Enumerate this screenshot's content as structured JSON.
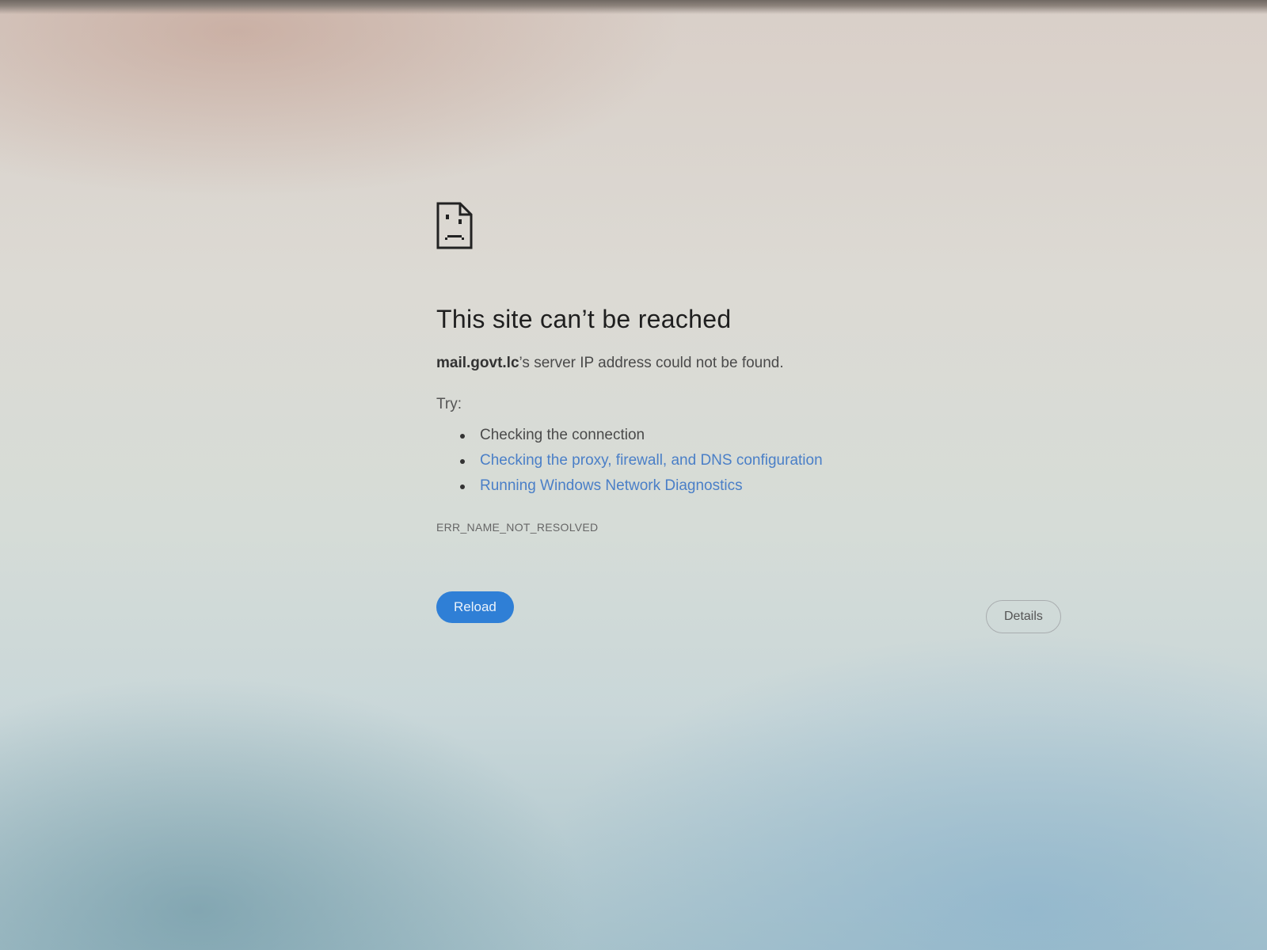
{
  "error_page": {
    "icon": "sad-file-icon",
    "headline": "This site can’t be reached",
    "summary_host": "mail.govt.lc",
    "summary_rest": "’s server IP address could not be found.",
    "try_label": "Try:",
    "suggestions": [
      {
        "text": "Checking the connection",
        "is_link": false
      },
      {
        "text": "Checking the proxy, firewall, and DNS configuration",
        "is_link": true
      },
      {
        "text": "Running Windows Network Diagnostics",
        "is_link": true
      }
    ],
    "error_code": "ERR_NAME_NOT_RESOLVED",
    "reload_label": "Reload",
    "details_label": "Details"
  },
  "colors": {
    "primary_button": "#2f7fd6",
    "link": "#4a7fc7"
  }
}
